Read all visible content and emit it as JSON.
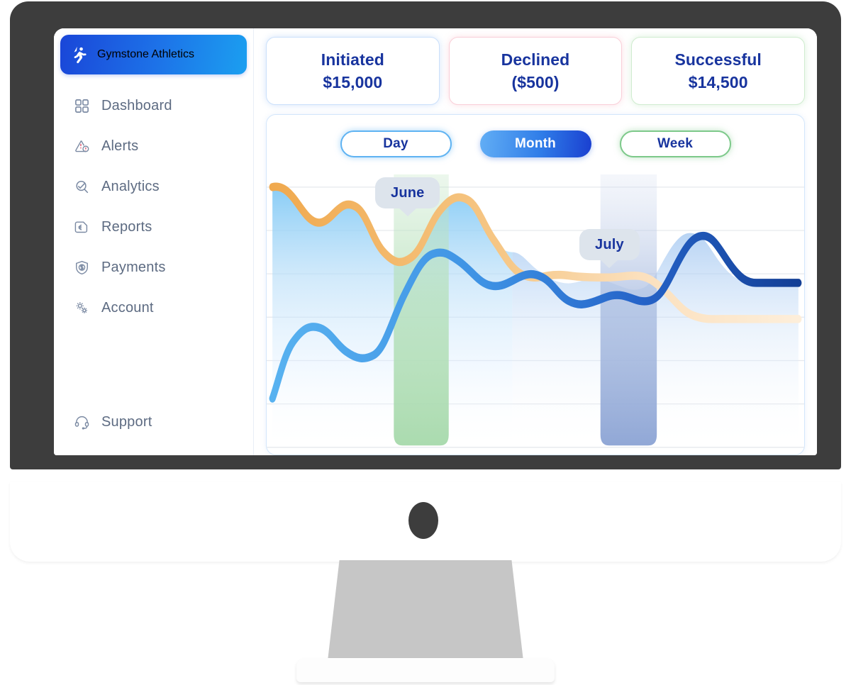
{
  "brand": {
    "title": "Gymstone Athletics",
    "logo_icon": "athlete-logo-icon"
  },
  "sidebar": {
    "items": [
      {
        "label": "Dashboard",
        "icon": "grid-icon"
      },
      {
        "label": "Alerts",
        "icon": "warning-triangle-icon"
      },
      {
        "label": "Analytics",
        "icon": "magnifier-chart-icon"
      },
      {
        "label": "Reports",
        "icon": "document-euro-icon"
      },
      {
        "label": "Payments",
        "icon": "shield-dollar-icon"
      },
      {
        "label": "Account",
        "icon": "gears-icon"
      }
    ],
    "support": {
      "label": "Support",
      "icon": "headset-icon"
    }
  },
  "stats": [
    {
      "label": "Initiated",
      "value": "$15,000",
      "tone": "tone-blue",
      "color": "#cbe0fb"
    },
    {
      "label": "Declined",
      "value": "($500)",
      "tone": "tone-red",
      "color": "#f9cfd8"
    },
    {
      "label": "Successful",
      "value": "$14,500",
      "tone": "tone-green",
      "color": "#cfeccf"
    }
  ],
  "range_toggle": {
    "options": [
      {
        "label": "Day",
        "style": "style-day",
        "active": false
      },
      {
        "label": "Month",
        "style": "style-month",
        "active": true
      },
      {
        "label": "Week",
        "style": "style-week",
        "active": false
      }
    ],
    "selected": "Month"
  },
  "chart_data": {
    "type": "line",
    "title": "",
    "xlabel": "",
    "ylabel": "",
    "grid": true,
    "gridlines": 7,
    "legend": "none",
    "annotations": [
      {
        "label": "June",
        "band_color": "#a9dcae",
        "band_x_start": 0.23,
        "band_x_end": 0.34
      },
      {
        "label": "July",
        "band_color": "#8fa6d8",
        "band_x_start": 0.62,
        "band_x_end": 0.74
      }
    ],
    "series": [
      {
        "name": "Initiated",
        "color_start": "#f3b85f",
        "color_end": "#fbe6c9",
        "values": [
          96,
          90,
          77,
          80,
          84,
          72,
          54,
          56,
          74,
          91,
          92,
          80,
          62,
          58,
          60,
          60,
          62,
          65,
          66,
          66,
          64,
          60,
          47,
          44,
          46,
          46
        ]
      },
      {
        "name": "Successful",
        "color_start": "#5ab2ee",
        "color_end": "#17499e",
        "values": [
          8,
          22,
          38,
          48,
          52,
          50,
          45,
          41,
          40,
          44,
          57,
          72,
          80,
          81,
          74,
          68,
          70,
          69,
          60,
          52,
          54,
          53,
          58,
          78,
          88,
          74,
          66,
          66
        ]
      }
    ],
    "ylim": [
      0,
      100
    ]
  },
  "tooltips": {
    "june": "June",
    "july": "July"
  }
}
